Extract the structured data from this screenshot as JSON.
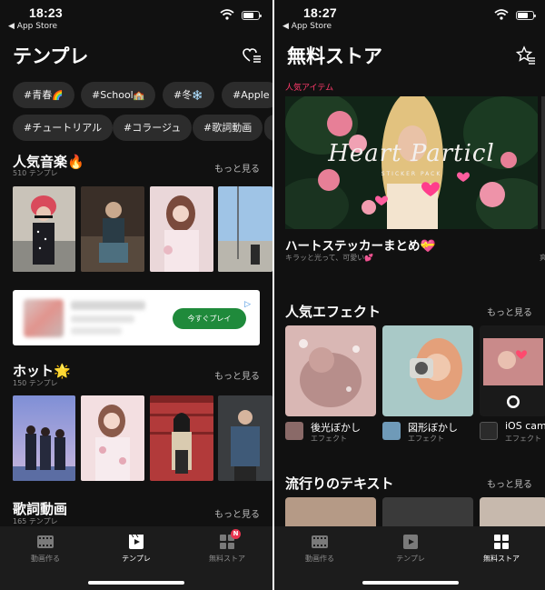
{
  "left": {
    "status": {
      "time": "18:23",
      "back": "◀ App Store"
    },
    "title": "テンプレ",
    "tags_row1": [
      {
        "text": "#青春",
        "emoji": "🌈"
      },
      {
        "text": "#School",
        "emoji": "🏫"
      },
      {
        "text": "#冬",
        "emoji": "❄️"
      },
      {
        "text": "#Apple",
        "emoji": ""
      }
    ],
    "tags_row2": [
      {
        "text": "#チュートリアル"
      },
      {
        "text": "#コラージュ"
      },
      {
        "text": "#歌詞動画"
      }
    ],
    "section_music": {
      "title": "人気音楽🔥",
      "count": "510 テンプレ",
      "more": "もっと見る"
    },
    "ad": {
      "cta": "今すぐプレイ",
      "badge": "▷"
    },
    "section_hot": {
      "title": "ホット🌟",
      "count": "150 テンプレ",
      "more": "もっと見る"
    },
    "section_lyrics": {
      "title": "歌詞動画",
      "count": "165 テンプレ",
      "more": "もっと見る"
    },
    "tabs": [
      {
        "label": "動画作る",
        "icon": "film-icon"
      },
      {
        "label": "テンプレ",
        "icon": "template-icon"
      },
      {
        "label": "無料ストア",
        "icon": "store-icon",
        "badge": "N"
      }
    ]
  },
  "right": {
    "status": {
      "time": "18:27",
      "back": "◀ App Store"
    },
    "title": "無料ストア",
    "label_popular_items": "人気アイテム",
    "hero": {
      "script": "Heart Particl",
      "sub": "STICKER PACK"
    },
    "item_title": "ハートステッカーまとめ💝",
    "item_sub": "キラッと光って、可愛い💕",
    "item_next_sub": "爽",
    "effects_section": {
      "title": "人気エフェクト",
      "more": "もっと見る"
    },
    "effects": [
      {
        "name": "後光ぼかし",
        "kind": "エフェクト"
      },
      {
        "name": "図形ぼかし",
        "kind": "エフェクト"
      },
      {
        "name": "iOS cam",
        "kind": "エフェクト"
      }
    ],
    "text_section": {
      "title": "流行りのテキスト",
      "more": "もっと見る"
    },
    "tabs": [
      {
        "label": "動画作る",
        "icon": "film-icon"
      },
      {
        "label": "テンプレ",
        "icon": "template-icon"
      },
      {
        "label": "無料ストア",
        "icon": "store-icon"
      }
    ]
  },
  "colors": {
    "background": "#111111",
    "accent_pink": "#ff3b6b",
    "tag_bg": "#2c2c2c",
    "ad_button": "#1f8a3b",
    "tabbar": "#1c1c1c"
  }
}
